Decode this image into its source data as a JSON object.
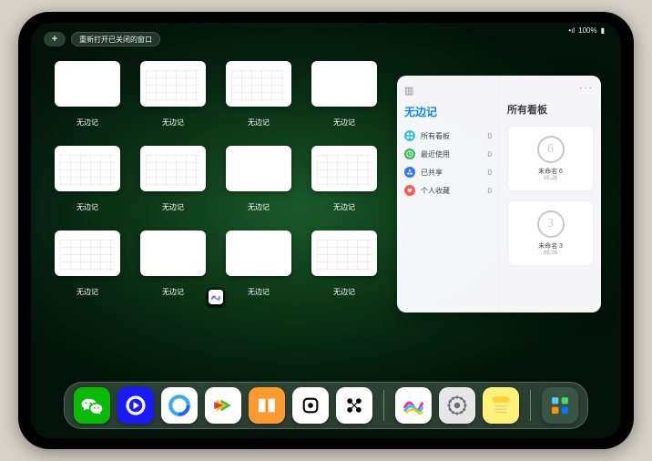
{
  "status": {
    "signal": "•ıl",
    "wifi": "⌇",
    "battery": "100%"
  },
  "reopen_label": "重新打开已关闭的窗口",
  "thumb_label": "无边记",
  "thumbs": [
    {
      "variant": "blank"
    },
    {
      "variant": "grid"
    },
    {
      "variant": "grid"
    },
    {
      "variant": "blank"
    },
    {
      "variant": "grid"
    },
    {
      "variant": "grid"
    },
    {
      "variant": "blank"
    },
    {
      "variant": "grid"
    },
    {
      "variant": "grid"
    },
    {
      "variant": "blank"
    },
    {
      "variant": "blank"
    },
    {
      "variant": "grid"
    }
  ],
  "sidebar": {
    "title": "无边记",
    "items": [
      {
        "icon_color": "#32c3e6",
        "icon": "grid",
        "label": "所有看板",
        "count": "0"
      },
      {
        "icon_color": "#2fbb57",
        "icon": "clock",
        "label": "最近使用",
        "count": "0"
      },
      {
        "icon_color": "#3478f6",
        "icon": "share",
        "label": "已共享",
        "count": "0"
      },
      {
        "icon_color": "#ff5a52",
        "icon": "heart",
        "label": "个人收藏",
        "count": "0"
      }
    ],
    "right_heading": "所有看板",
    "boards": [
      {
        "scribble": "6",
        "title": "未命名 6",
        "time": "05:28"
      },
      {
        "scribble": "3",
        "title": "未命名 3",
        "time": "05:26"
      }
    ]
  },
  "dock": [
    {
      "name": "wechat",
      "bg": "#09bb07"
    },
    {
      "name": "tencent-video",
      "bg": "#1a1aff"
    },
    {
      "name": "qq-browser",
      "bg": "#ffffff"
    },
    {
      "name": "bilibili",
      "bg": "#ffffff"
    },
    {
      "name": "books",
      "bg": "#ff9a2e"
    },
    {
      "name": "unknown-dice",
      "bg": "#ffffff"
    },
    {
      "name": "unknown-dots",
      "bg": "#ffffff"
    },
    {
      "name": "freeform",
      "bg": "#ffffff"
    },
    {
      "name": "settings",
      "bg": "#e7e7ea"
    },
    {
      "name": "notes",
      "bg": "#fff27a"
    },
    {
      "name": "app-library",
      "bg": "#3a5544"
    }
  ]
}
